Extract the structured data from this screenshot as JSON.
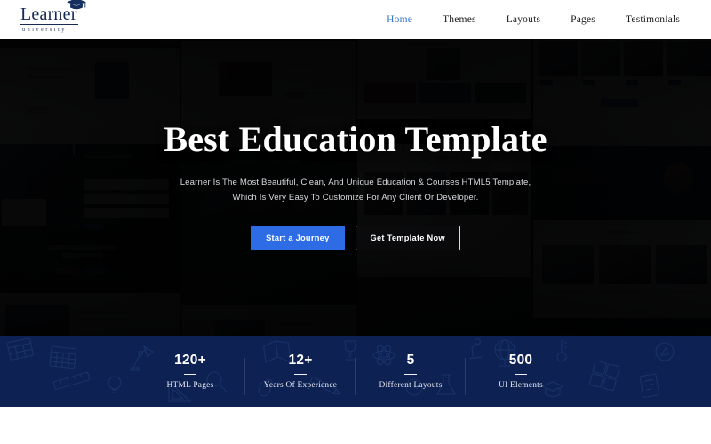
{
  "header": {
    "logo": {
      "word": "Learner",
      "sub": "university",
      "icon": "graduation-cap-icon"
    },
    "nav": [
      {
        "label": "Home",
        "active": true
      },
      {
        "label": "Themes",
        "active": false
      },
      {
        "label": "Layouts",
        "active": false
      },
      {
        "label": "Pages",
        "active": false
      },
      {
        "label": "Testimonials",
        "active": false
      }
    ]
  },
  "hero": {
    "title": "Best Education Template",
    "subtitle_line1": "Learner Is The Most Beautiful, Clean, And Unique Education & Courses HTML5 Template,",
    "subtitle_line2": "Which Is Very Easy To Customize For Any Client Or Developer.",
    "primary_button": "Start a Journey",
    "secondary_button": "Get Template Now"
  },
  "stats": [
    {
      "number": "120+",
      "label": "HTML Pages"
    },
    {
      "number": "12+",
      "label": "Years Of Experience"
    },
    {
      "number": "5",
      "label": "Different Layouts"
    },
    {
      "number": "500",
      "label": "UI Elements"
    }
  ],
  "colors": {
    "accent_blue": "#2d6ce5",
    "nav_active": "#2f74d0",
    "stats_bg": "#0d2152",
    "logo_navy": "#152a54",
    "hero_bg": "#0a0a0c"
  }
}
